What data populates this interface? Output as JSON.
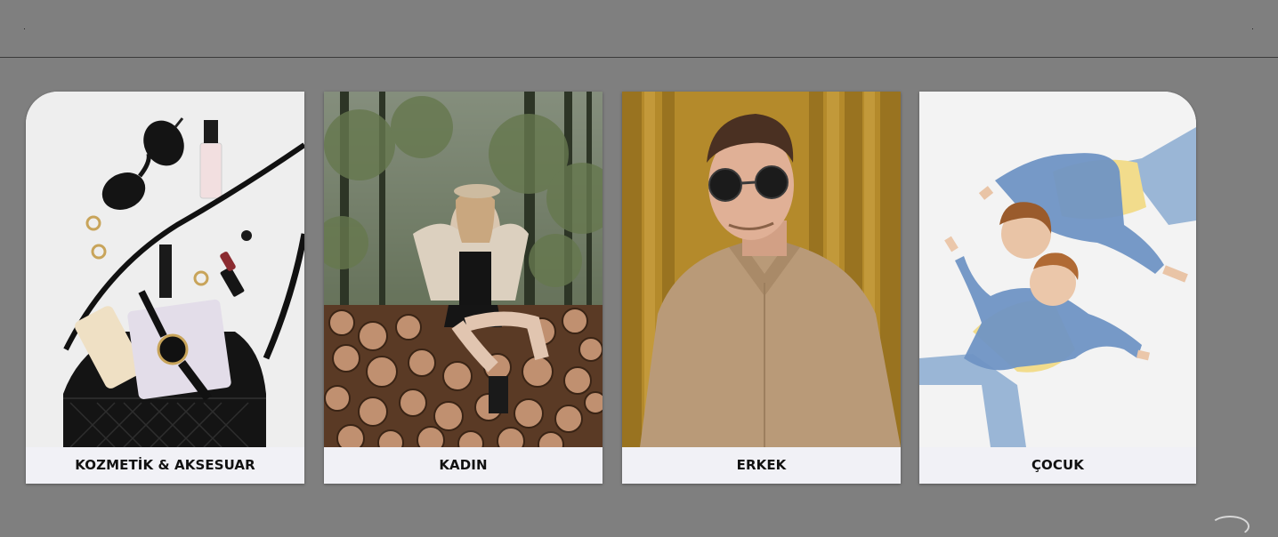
{
  "categories": [
    {
      "label": "KOZMETİK & AKSESUAR",
      "image": "accessories-flatlay-photo"
    },
    {
      "label": "KADIN",
      "image": "woman-forest-photo"
    },
    {
      "label": "ERKEK",
      "image": "man-sunglasses-photo"
    },
    {
      "label": "ÇOCUK",
      "image": "children-denim-photo"
    }
  ],
  "colors": {
    "page_background": "#7f7f7f",
    "card_label_background": "#f1f1f6",
    "label_text": "#111111"
  }
}
